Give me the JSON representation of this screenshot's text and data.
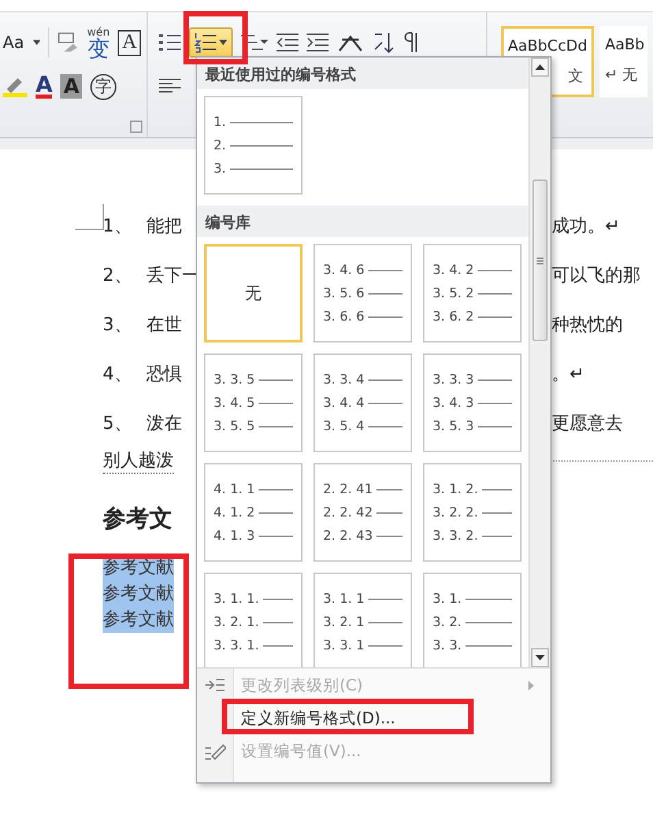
{
  "ribbon": {
    "font_size_label": "Aa",
    "phonetic_top": "wén",
    "phonetic_char": "变",
    "char_border_label": "A",
    "font_color_label": "A",
    "shading_label": "A",
    "enclose_label": "字",
    "numbering_button": {
      "selected": true
    },
    "styles": [
      {
        "preview": "AaBbCcDd",
        "name": "文",
        "selected": true
      },
      {
        "preview": "AaBb",
        "name": "↵ 无",
        "selected": false
      }
    ]
  },
  "document": {
    "list": [
      {
        "number": "1、",
        "left": "能把",
        "right": "成功。↵"
      },
      {
        "number": "2、",
        "left": "丢下一",
        "right": "可以飞的那"
      },
      {
        "number": "3、",
        "left": "在世",
        "right": "种热忱的"
      },
      {
        "number": "4、",
        "left": "恐惧",
        "right": "。↵"
      },
      {
        "number": "5、",
        "left": "泼在",
        "right": "更愿意去"
      }
    ],
    "wrapped_line": "别人越泼",
    "heading": "参考文",
    "selected_lines": [
      "参考文献",
      "参考文献",
      "参考文献"
    ]
  },
  "numbering_menu": {
    "recent_header": "最近使用过的编号格式",
    "recent": [
      {
        "lines": [
          "1.",
          "2.",
          "3."
        ]
      }
    ],
    "library_header": "编号库",
    "library": [
      {
        "kind": "none",
        "label": "无",
        "selected": true
      },
      {
        "kind": "list",
        "lines": [
          "3. 4. 6",
          "3. 5. 6",
          "3. 6. 6"
        ],
        "selected": false
      },
      {
        "kind": "list",
        "lines": [
          "3. 4. 2",
          "3. 5. 2",
          "3. 6. 2"
        ],
        "selected": false
      },
      {
        "kind": "list",
        "lines": [
          "3. 3. 5",
          "3. 4. 5",
          "3. 5. 5"
        ],
        "selected": false
      },
      {
        "kind": "list",
        "lines": [
          "3. 3. 4",
          "3. 4. 4",
          "3. 5. 4"
        ],
        "selected": false
      },
      {
        "kind": "list",
        "lines": [
          "3. 3. 3",
          "3. 4. 3",
          "3. 5. 3"
        ],
        "selected": false
      },
      {
        "kind": "list",
        "lines": [
          "4. 1. 1",
          "4. 1. 2",
          "4. 1. 3"
        ],
        "selected": false
      },
      {
        "kind": "list",
        "lines": [
          "2. 2. 41",
          "2. 2. 42",
          "2. 2. 43"
        ],
        "selected": false
      },
      {
        "kind": "list",
        "lines": [
          "3. 1. 2.",
          "3. 2. 2.",
          "3. 3. 2."
        ],
        "selected": false
      },
      {
        "kind": "list",
        "lines": [
          "3. 1. 1.",
          "3. 2. 1.",
          "3. 3. 1."
        ],
        "selected": false
      },
      {
        "kind": "list",
        "lines": [
          "3. 1. 1",
          "3. 2. 1",
          "3. 3. 1"
        ],
        "selected": false
      },
      {
        "kind": "list",
        "lines": [
          "3. 1.",
          "3. 2.",
          "3. 3."
        ],
        "selected": false
      }
    ],
    "commands": [
      {
        "kind": "level",
        "label": "更改列表级别(C)",
        "disabled": true,
        "submenu": true
      },
      {
        "kind": "define",
        "label": "定义新编号格式(D)...",
        "disabled": false,
        "submenu": false
      },
      {
        "kind": "value",
        "label": "设置编号值(V)...",
        "disabled": true,
        "submenu": false
      }
    ]
  }
}
